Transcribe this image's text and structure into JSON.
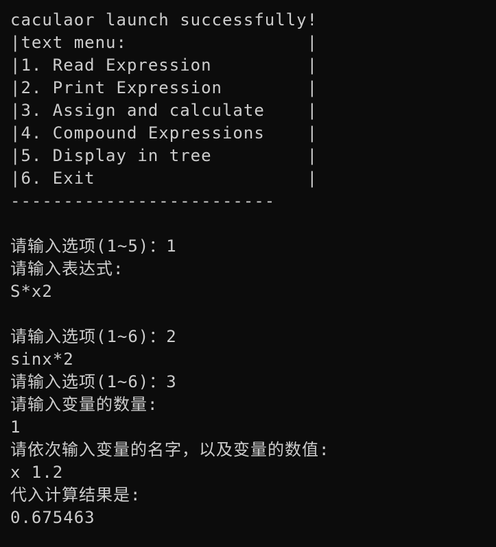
{
  "terminal": {
    "lines": [
      "caculaor launch successfully!",
      "|text menu:                 |",
      "|1. Read Expression         |",
      "|2. Print Expression        |",
      "|3. Assign and calculate    |",
      "|4. Compound Expressions    |",
      "|5. Display in tree         |",
      "|6. Exit                    |",
      "-------------------------",
      "",
      "请输入选项(1~5)：1",
      "请输入表达式:",
      "S*x2",
      "",
      "请输入选项(1~6)：2",
      "sinx*2",
      "请输入选项(1~6)：3",
      "请输入变量的数量:",
      "1",
      "请依次输入变量的名字，以及变量的数值:",
      "x 1.2",
      "代入计算结果是:",
      "0.675463"
    ]
  },
  "colors": {
    "background": "#0c0c0c",
    "foreground": "#cccccc"
  }
}
